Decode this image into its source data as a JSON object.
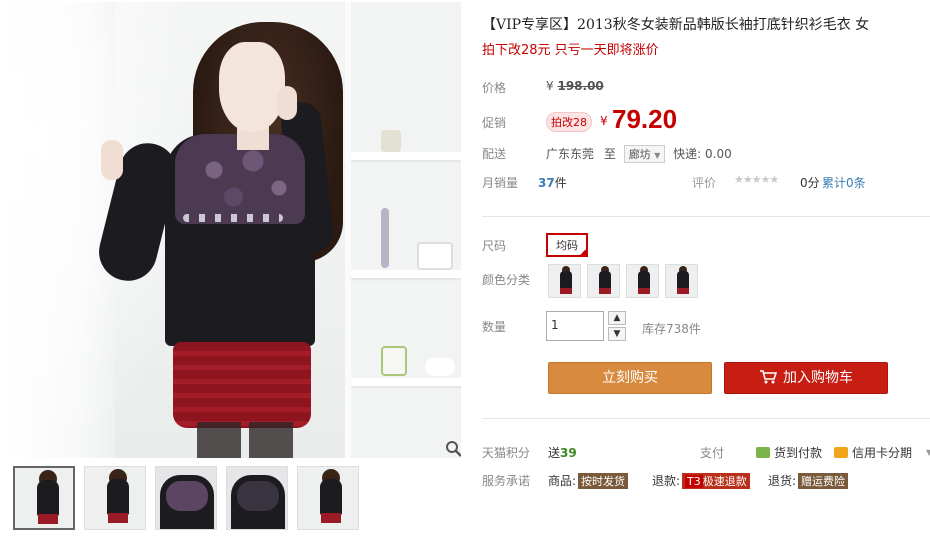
{
  "product": {
    "title": "【VIP专享区】2013秋冬女装新品韩版长袖打底针织衫毛衣 女",
    "subtitle": "拍下改28元 只亏一天即将涨价"
  },
  "pricing": {
    "original_label": "价格",
    "currency": "¥",
    "original_price": "198.00",
    "promo_label": "促销",
    "promo_tag": "拍改28",
    "promo_price": "79.20"
  },
  "shipping": {
    "label": "配送",
    "from": "广东东莞",
    "to_word": "至",
    "destination": "廊坊",
    "fee": "快递: 0.00"
  },
  "sales": {
    "label": "月销量",
    "count": "37",
    "unit": "件",
    "rating_label": "评价",
    "stars": "★★★★★",
    "rating": "0分",
    "review_count": "累计0条"
  },
  "options": {
    "size_label": "尺码",
    "size_value": "均码",
    "color_label": "颜色分类",
    "color_count": 4,
    "quantity_label": "数量",
    "quantity_value": "1",
    "stock": "库存738件"
  },
  "actions": {
    "buy_now": "立刻购买",
    "add_to_cart": "加入购物车"
  },
  "extras": {
    "points_label": "天猫积分",
    "points_prefix": "送",
    "points_value": "39",
    "pay_label": "支付",
    "pay_cod": "货到付款",
    "pay_credit": "信用卡分期",
    "service_label": "服务承诺",
    "svc_goods": "商品:",
    "svc_goods_tag": "按时发货",
    "svc_refund": "退款:",
    "svc_refund_badge": "T3",
    "svc_refund_tag": "极速退款",
    "svc_return": "退货:",
    "svc_return_tag": "赠运费险"
  },
  "gallery": {
    "thumbnail_count": 5,
    "active_index": 0
  },
  "colors": {
    "accent_red": "#c40000",
    "buy_orange": "#d88a3e",
    "cart_red": "#c71d12",
    "link_blue": "#3c7bb5"
  }
}
